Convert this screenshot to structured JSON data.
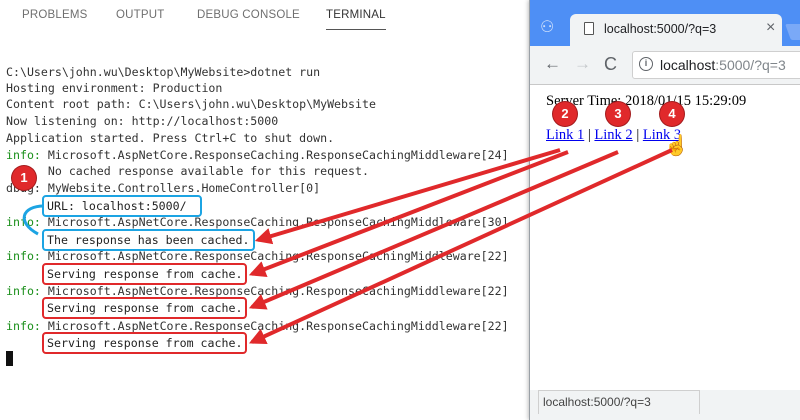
{
  "panel_tabs": [
    {
      "label": "PROBLEMS"
    },
    {
      "label": "OUTPUT"
    },
    {
      "label": "DEBUG CONSOLE"
    },
    {
      "label": "TERMINAL"
    }
  ],
  "terminal": {
    "lines": [
      {
        "prefix": "",
        "text": "C:\\Users\\john.wu\\Desktop\\MyWebsite>dotnet run"
      },
      {
        "prefix": "",
        "text": "Hosting environment: Production"
      },
      {
        "prefix": "",
        "text": "Content root path: C:\\Users\\john.wu\\Desktop\\MyWebsite"
      },
      {
        "prefix": "",
        "text": "Now listening on: http://localhost:5000"
      },
      {
        "prefix": "",
        "text": "Application started. Press Ctrl+C to shut down."
      },
      {
        "prefix": "info:",
        "text": " Microsoft.AspNetCore.ResponseCaching.ResponseCachingMiddleware[24]"
      },
      {
        "prefix": "",
        "text": "      No cached response available for this request."
      },
      {
        "prefix": "dbug:",
        "text": " MyWebsite.Controllers.HomeController[0]"
      },
      {
        "prefix": "",
        "text": ""
      },
      {
        "prefix": "info:",
        "text": " Microsoft.AspNetCore.ResponseCaching.ResponseCachingMiddleware[30]"
      },
      {
        "prefix": "",
        "text": ""
      },
      {
        "prefix": "info:",
        "text": " Microsoft.AspNetCore.ResponseCaching.ResponseCachingMiddleware[22]"
      },
      {
        "prefix": "",
        "text": ""
      },
      {
        "prefix": "",
        "text": ""
      },
      {
        "prefix": "info:",
        "text": " Microsoft.AspNetCore.ResponseCaching.ResponseCachingMiddleware[22]"
      },
      {
        "prefix": "",
        "text": ""
      },
      {
        "prefix": "",
        "text": ""
      },
      {
        "prefix": "info:",
        "text": " Microsoft.AspNetCore.ResponseCaching.ResponseCachingMiddleware[22]"
      }
    ],
    "highlights": {
      "url": "URL: localhost:5000/",
      "cached": "The response has been cached.",
      "serving_1": "Serving response from cache.",
      "serving_2": "Serving response from cache.",
      "serving_3": "Serving response from cache."
    }
  },
  "browser": {
    "tab_title": "localhost:5000/?q=3",
    "tab_close": "×",
    "address_host": "localhost",
    "address_rest": ":5000/?q=3",
    "info_glyph": "i",
    "back_glyph": "←",
    "forward_glyph": "→",
    "reload_glyph": "C",
    "server_time": "Server Time: 2018/01/15 15:29:09",
    "links": [
      {
        "label": "Link 1"
      },
      {
        "label": "Link 2"
      },
      {
        "label": "Link 3"
      }
    ],
    "separator": " | ",
    "status_url": "localhost:5000/?q=3"
  },
  "badges": [
    "1",
    "2",
    "3",
    "4"
  ],
  "colors": {
    "annotation_red": "#e0292b",
    "annotation_blue": "#1ca4e3",
    "info_green": "#1a8f1a",
    "titlebar_blue": "#4e8ff5"
  }
}
